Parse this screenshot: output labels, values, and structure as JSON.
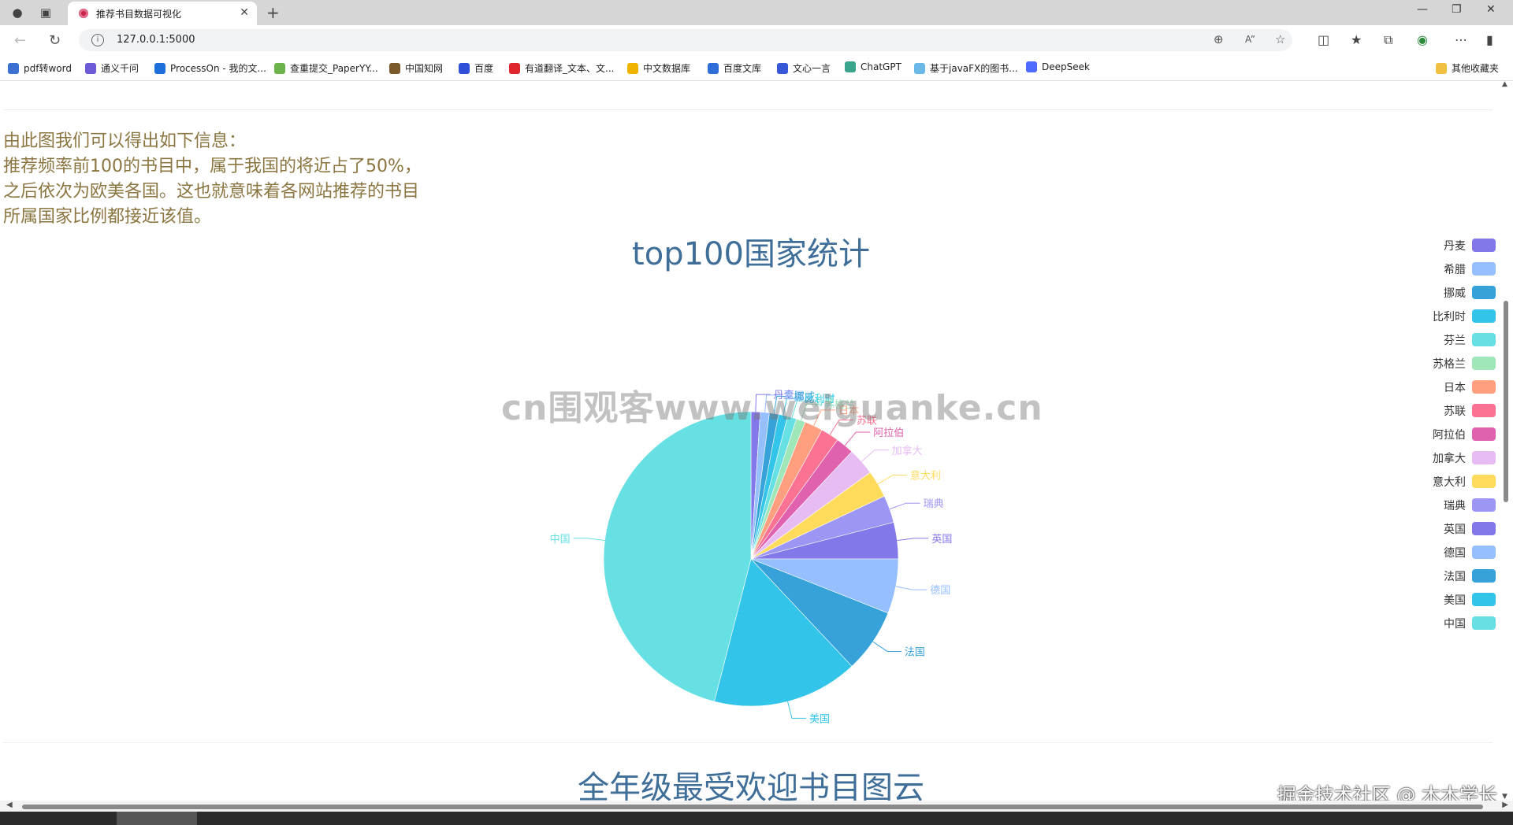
{
  "browser": {
    "tab_title": "推荐书目数据可视化",
    "url": "127.0.0.1:5000",
    "bookmarks": [
      {
        "label": "pdf转word",
        "color": "#3b6fd1"
      },
      {
        "label": "通义千问",
        "color": "#6b5bd6"
      },
      {
        "label": "ProcessOn - 我的文...",
        "color": "#1d6fdc"
      },
      {
        "label": "查重提交_PaperYY...",
        "color": "#6cb24a"
      },
      {
        "label": "中国知网",
        "color": "#7a5a2a"
      },
      {
        "label": "百度",
        "color": "#2f4fd8"
      },
      {
        "label": "有道翻译_文本、文...",
        "color": "#e0262d"
      },
      {
        "label": "中文数据库",
        "color": "#f0b400"
      },
      {
        "label": "百度文库",
        "color": "#2f6ed8"
      },
      {
        "label": "文心一言",
        "color": "#3657d8"
      },
      {
        "label": "ChatGPT",
        "color": "#3aa58a"
      },
      {
        "label": "基于javaFX的图书...",
        "color": "#6ab8e8"
      },
      {
        "label": "DeepSeek",
        "color": "#4d6bfe"
      }
    ],
    "other_bookmarks": "其他收藏夹"
  },
  "page": {
    "note_lines": [
      "由此图我们可以得出如下信息：",
      "推荐频率前100的书目中，属于我国的将近占了50%，",
      "之后依次为欧美各国。这也就意味着各网站推荐的书目",
      "所属国家比例都接近该值。"
    ],
    "next_chart_title": "全年级最受欢迎书目图云",
    "watermark": "cn围观客www.weiguanke.cn",
    "footer_watermark": "掘金技术社区 @ 木木学长"
  },
  "chart_data": {
    "type": "pie",
    "title": "top100国家统计",
    "legend_position": "right",
    "slices": [
      {
        "name": "丹麦",
        "value": 1,
        "color": "#8378ea"
      },
      {
        "name": "希腊",
        "value": 1,
        "color": "#96bfff"
      },
      {
        "name": "挪威",
        "value": 1,
        "color": "#37a2da"
      },
      {
        "name": "比利时",
        "value": 1,
        "color": "#32c5e9"
      },
      {
        "name": "芬兰",
        "value": 1,
        "color": "#67e0e3"
      },
      {
        "name": "苏格兰",
        "value": 1,
        "color": "#9fe6b8"
      },
      {
        "name": "日本",
        "value": 2,
        "color": "#ff9f7f"
      },
      {
        "name": "苏联",
        "value": 2,
        "color": "#fb7293"
      },
      {
        "name": "阿拉伯",
        "value": 2,
        "color": "#e062ae"
      },
      {
        "name": "加拿大",
        "value": 3,
        "color": "#e7bcf3"
      },
      {
        "name": "意大利",
        "value": 3,
        "color": "#ffdb5c"
      },
      {
        "name": "瑞典",
        "value": 3,
        "color": "#9d96f5"
      },
      {
        "name": "英国",
        "value": 4,
        "color": "#8378ea"
      },
      {
        "name": "德国",
        "value": 6,
        "color": "#96bfff"
      },
      {
        "name": "法国",
        "value": 7,
        "color": "#37a2da"
      },
      {
        "name": "美国",
        "value": 16,
        "color": "#32c5e9"
      },
      {
        "name": "中国",
        "value": 46,
        "color": "#67e0e3"
      }
    ]
  }
}
